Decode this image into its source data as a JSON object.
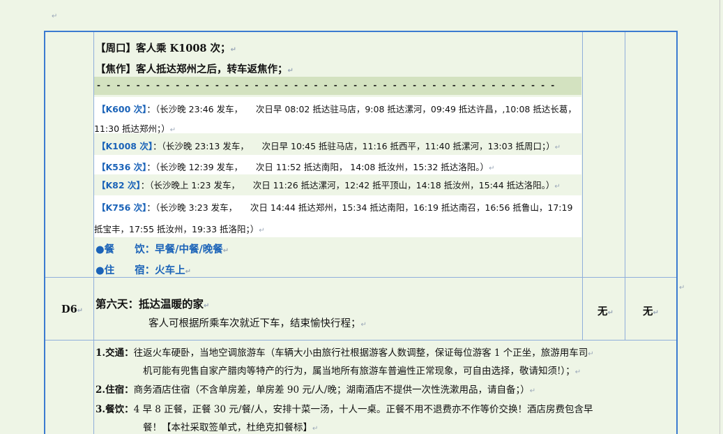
{
  "paragraph_mark": "↵",
  "block1": {
    "zhoukou": "【周口】客人乘 K1008 次；",
    "jiaozuo": "【焦作】客人抵达郑州之后，转车返焦作；",
    "dashes": "- - - - - - - - - - - - - - - - - - - - - - - - - - - - - - - - - - - - - - - - - - - - - - -",
    "trains": [
      {
        "name": "【K600 次】",
        "line1": "：（长沙晚 23:46 发车，　　次日早 08:02 抵达驻马店，9:08 抵达漯河，09:49 抵达许昌，,10:08 抵达长葛，",
        "line2": "11:30 抵达郑州；）"
      },
      {
        "name": "【K1008 次】",
        "line1": "：（长沙晚 23:13 发车，　　次日早 10:45 抵驻马店，11:16 抵西平，11:40 抵漯河，13:03 抵周口；）"
      },
      {
        "name": "【K536 次】",
        "line1": "：（长沙晚 12:39 发车，　　次日 11:52 抵达南阳， 14:08 抵汝州，15:32 抵达洛阳。）"
      },
      {
        "name": "【K82 次】",
        "line1": "：（长沙晚上 1:23 发车，　　次日 11:26 抵达漯河，12:42 抵平顶山，14:18 抵汝州，15:44 抵达洛阳。）"
      },
      {
        "name": "【K756 次】",
        "line1": "：（长沙晚 3:23 发车，　　次日 14:44 抵达郑州，15:34 抵达南阳，16:19 抵达南召，16:56 抵鲁山，17:19",
        "line2": "抵宝丰，17:55 抵汝州，19:33 抵洛阳；）"
      }
    ],
    "meals": "●餐　　饮：早餐/中餐/晚餐",
    "lodging": "●住　　宿：火车上"
  },
  "day6": {
    "label": "D6",
    "title": "第六天：抵达温暖的家",
    "desc": "客人可根据所乘车次就近下车，结束愉快行程；",
    "col3": "无",
    "col4": "无"
  },
  "notes": {
    "n1_label": "1.交通：",
    "n1_text": "往返火车硬卧，当地空调旅游车（车辆大小由旅行社根据游客人数调整，保证每位游客 1 个正坐，旅游用车司",
    "n1_text2": "机可能有兜售自家产腊肉等特产的行为，属当地所有旅游车普遍性正常现象，可自由选择，敬请知须!）；",
    "n2_label": "2.住宿：",
    "n2_text": "商务酒店住宿（不含单房差，单房差 90 元/人/晚；湖南酒店不提供一次性洗漱用品，请自备；）",
    "n3_label": "3.餐饮：",
    "n3_text": "4 早 8 正餐，正餐 30 元/餐/人，安排十菜一汤，十人一桌。正餐不用不退费亦不作等价交换！酒店房费包含早",
    "n3_text2": "餐！【本社采取签单式，杜绝克扣餐标】"
  },
  "colors": {
    "border": "#3b7ad0",
    "blue_text": "#1b63b8",
    "dash_row": "#d3e2c0",
    "page": "#eef5e6"
  }
}
